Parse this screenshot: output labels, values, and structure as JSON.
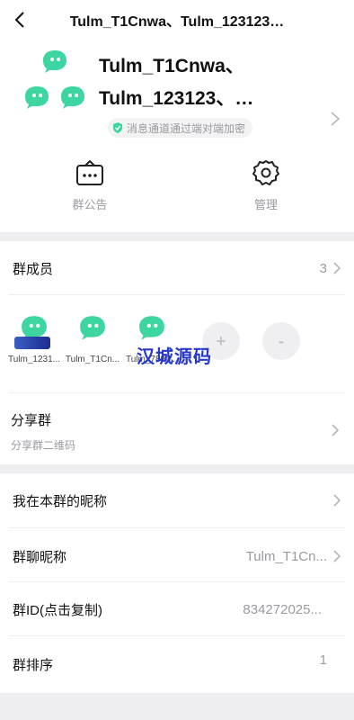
{
  "nav": {
    "title": "Tulm_T1Cnwa、Tulm_123123…",
    "back_icon": "chevron-left-icon"
  },
  "group": {
    "name_line1": "Tulm_T1Cnwa、",
    "name_line2": "Tulm_123123、…",
    "encrypt_text": "消息通道通过端对端加密",
    "avatar_color": "#3ed6a0"
  },
  "quick_actions": [
    {
      "label": "群公告",
      "icon": "announcement-icon"
    },
    {
      "label": "管理",
      "icon": "gear-icon"
    }
  ],
  "members_row": {
    "label": "群成员",
    "count": "3"
  },
  "members": [
    {
      "name": "Tulm_1231..."
    },
    {
      "name": "Tulm_T1Cn..."
    },
    {
      "name": "Tulm_7897..."
    }
  ],
  "member_actions": {
    "add": "+",
    "remove": "-"
  },
  "watermark": {
    "text": "汉城源码"
  },
  "share": {
    "title": "分享群",
    "subtitle": "分享群二维码"
  },
  "settings": [
    {
      "label": "我在本群的昵称",
      "value": ""
    },
    {
      "label": "群聊昵称",
      "value": "Tulm_T1Cn..."
    },
    {
      "label": "群ID(点击复制)",
      "value": "834272025..."
    },
    {
      "label": "群排序",
      "value": "1"
    }
  ],
  "colors": {
    "accent": "#3ed6a0",
    "separator": "#eeeef0",
    "muted": "#9a9aa0"
  }
}
